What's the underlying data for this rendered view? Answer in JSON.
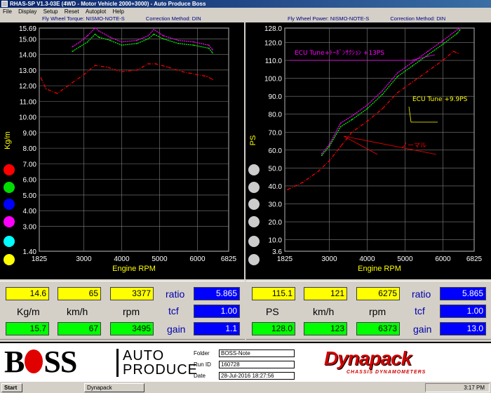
{
  "window": {
    "title": "RHAS-SP V1.3-03E  (4WD - Motor Vehicle 2000+3000) - Auto Produce Boss"
  },
  "menu": [
    "File",
    "Display",
    "Setup",
    "Reset",
    "Autoplot",
    "Help"
  ],
  "left_header": {
    "torque": "Fly Wheel Torque: NISMO-NOTE-S",
    "method": "Correction Method: DIN"
  },
  "right_header": {
    "power": "Fly Wheel Power: NISMO-NOTE-S",
    "method": "Correction Method: DIN"
  },
  "legend_colors": [
    "#ff0000",
    "#00dd00",
    "#0000ff",
    "#ff00ff",
    "#00ffff",
    "#ffff00"
  ],
  "torque_chart": {
    "type": "line",
    "xlabel": "Engine RPM",
    "ylabel": "Kg/m",
    "xlim": [
      1825,
      6825
    ],
    "ylim": [
      1.4,
      15.69
    ],
    "x_ticks": [
      1825,
      3000,
      4000,
      5000,
      6000,
      6825
    ],
    "y_ticks": [
      1.4,
      3.0,
      4.0,
      5.0,
      6.0,
      7.0,
      8.0,
      9.0,
      10.0,
      11.0,
      12.0,
      13.0,
      14.0,
      15.0,
      15.69
    ],
    "series": [
      {
        "color": "#ff0000",
        "x": [
          1870,
          2000,
          2300,
          2700,
          3000,
          3300,
          3600,
          4000,
          4400,
          4700,
          4900,
          5200,
          5600,
          6000,
          6250,
          6400
        ],
        "y": [
          12.5,
          11.8,
          11.5,
          12.2,
          12.7,
          13.3,
          13.2,
          12.9,
          13.0,
          13.4,
          13.4,
          13.2,
          12.9,
          12.7,
          12.6,
          12.4
        ]
      },
      {
        "color": "#00ff00",
        "x": [
          2700,
          2900,
          3100,
          3300,
          3400,
          3700,
          4000,
          4400,
          4700,
          4850,
          5100,
          5500,
          5900,
          6300,
          6400
        ],
        "y": [
          14.2,
          14.5,
          14.8,
          15.3,
          15.1,
          14.9,
          14.6,
          14.7,
          15.0,
          15.3,
          15.0,
          14.7,
          14.6,
          14.4,
          14.1
        ]
      },
      {
        "color": "#ff00ff",
        "x": [
          2700,
          2900,
          3100,
          3300,
          3400,
          3700,
          4000,
          4400,
          4700,
          4850,
          5100,
          5500,
          5900,
          6300,
          6400
        ],
        "y": [
          14.5,
          14.8,
          15.2,
          15.7,
          15.5,
          15.1,
          14.8,
          14.9,
          15.2,
          15.6,
          15.2,
          14.9,
          14.8,
          14.6,
          14.3
        ]
      }
    ]
  },
  "power_chart": {
    "type": "line",
    "xlabel": "Engine RPM",
    "ylabel": "PS",
    "xlim": [
      1825,
      6825
    ],
    "ylim": [
      3.6,
      128.0
    ],
    "x_ticks": [
      1825,
      3000,
      4000,
      5000,
      6000,
      6825
    ],
    "y_ticks": [
      3.6,
      10.0,
      20.0,
      30.0,
      40.0,
      50.0,
      60.0,
      70.0,
      80.0,
      90.0,
      100.0,
      110.0,
      120.0,
      128.0
    ],
    "series": [
      {
        "color": "#ff0000",
        "x": [
          1900,
          2300,
          2700,
          3000,
          3300,
          3600,
          4000,
          4400,
          4800,
          5200,
          5600,
          6000,
          6275,
          6400
        ],
        "y": [
          38,
          42,
          48,
          54,
          62,
          70,
          76,
          83,
          92,
          98,
          104,
          110,
          115,
          114
        ]
      },
      {
        "color": "#00ff00",
        "x": [
          2800,
          3000,
          3300,
          3600,
          4000,
          4400,
          4800,
          5200,
          5600,
          6000,
          6373,
          6450
        ],
        "y": [
          57,
          62,
          73,
          77,
          83,
          91,
          101,
          107,
          113,
          119,
          125,
          127
        ]
      },
      {
        "color": "#ff00ff",
        "x": [
          2800,
          3000,
          3300,
          3600,
          4000,
          4400,
          4800,
          5200,
          5600,
          6000,
          6373,
          6450
        ],
        "y": [
          58,
          63,
          75,
          79,
          85,
          93,
          103,
          109,
          115,
          121,
          127,
          128
        ]
      }
    ],
    "annotations": [
      {
        "text": "ECU Tune+ﾄｰﾎﾞﾝｻｸｼｮﾝ +13PS",
        "color": "#ff00ff"
      },
      {
        "text": "ECU Tune +9.9PS",
        "color": "#ffff00"
      },
      {
        "text": "ノーマル",
        "color": "#ff0000"
      }
    ]
  },
  "left_panel": {
    "row1": [
      "14.6",
      "65",
      "3377"
    ],
    "units": [
      "Kg/m",
      "km/h",
      "rpm"
    ],
    "row3": [
      "15.7",
      "67",
      "3495"
    ],
    "ratio_label": "ratio",
    "ratio": "5.865",
    "tcf_label": "tcf",
    "tcf": "1.00",
    "gain_label": "gain",
    "gain": "1.1"
  },
  "right_panel": {
    "row1": [
      "115.1",
      "121",
      "6275"
    ],
    "units": [
      "PS",
      "km/h",
      "rpm"
    ],
    "row3": [
      "128.0",
      "123",
      "6373"
    ],
    "ratio_label": "ratio",
    "ratio": "5.865",
    "tcf_label": "tcf",
    "tcf": "1.00",
    "gain_label": "gain",
    "gain": "13.0"
  },
  "footer": {
    "boss_b": "B",
    "boss_ss": "SS",
    "auto": "AUTO",
    "produce": "PRODUCE",
    "folder_label": "Folder",
    "folder": "BOSS-Note",
    "run_label": "Run ID",
    "run": "160728",
    "date_label": "Date",
    "date": "28-Jul-2016  18:27:56",
    "brand": "Dynapack",
    "brand_sub": "CHASSIS DYNAMOMETERS"
  },
  "taskbar": {
    "start": "Start",
    "task": "Dynapack",
    "clock": "3:17 PM"
  }
}
